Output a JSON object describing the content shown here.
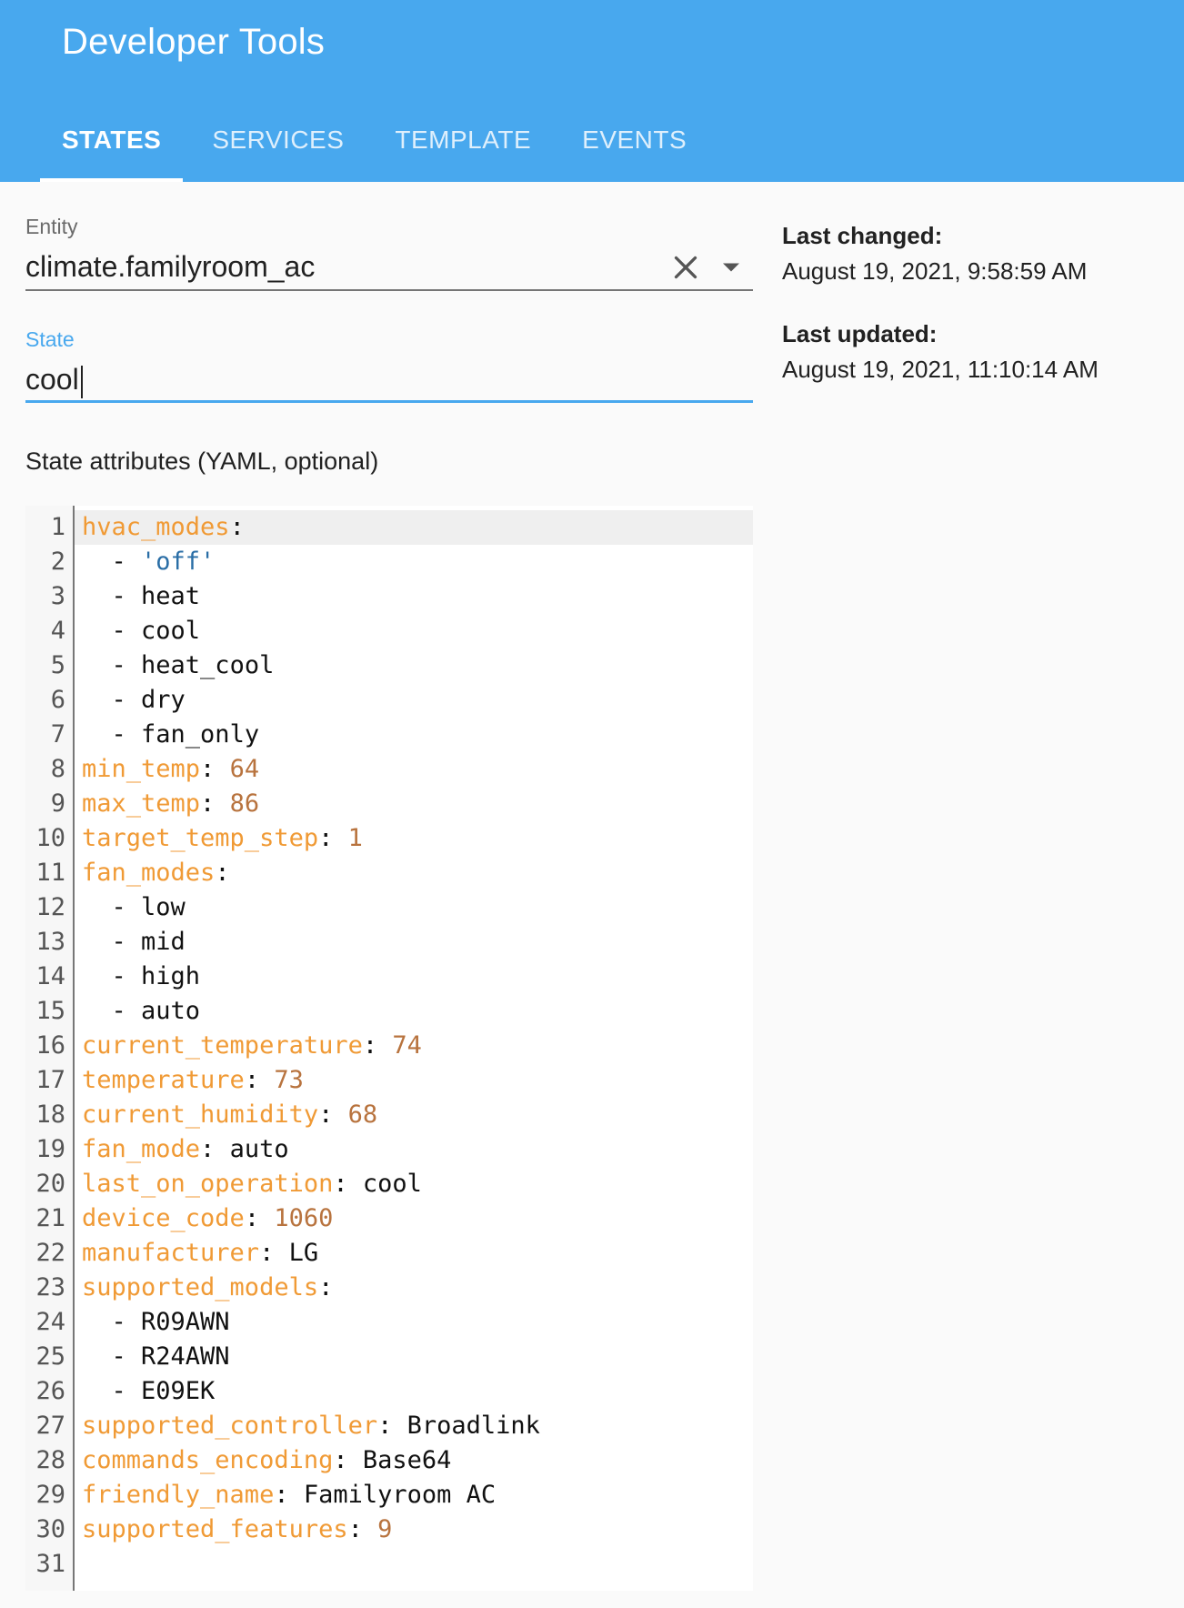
{
  "header": {
    "title": "Developer Tools",
    "tabs": [
      {
        "label": "STATES",
        "active": true
      },
      {
        "label": "SERVICES",
        "active": false
      },
      {
        "label": "TEMPLATE",
        "active": false
      },
      {
        "label": "EVENTS",
        "active": false
      }
    ]
  },
  "entity": {
    "label": "Entity",
    "value": "climate.familyroom_ac",
    "clear_icon": "close-icon",
    "dropdown_icon": "arrow-drop-down-icon"
  },
  "state": {
    "label": "State",
    "value": "cool"
  },
  "attributes": {
    "label": "State attributes (YAML, optional)",
    "lines": [
      {
        "n": "1",
        "key": "hvac_modes",
        "val": ""
      },
      {
        "n": "2",
        "item": "'off'",
        "item_type": "string"
      },
      {
        "n": "3",
        "item": "heat"
      },
      {
        "n": "4",
        "item": "cool"
      },
      {
        "n": "5",
        "item": "heat_cool"
      },
      {
        "n": "6",
        "item": "dry"
      },
      {
        "n": "7",
        "item": "fan_only"
      },
      {
        "n": "8",
        "key": "min_temp",
        "val": "64",
        "val_type": "number"
      },
      {
        "n": "9",
        "key": "max_temp",
        "val": "86",
        "val_type": "number"
      },
      {
        "n": "10",
        "key": "target_temp_step",
        "val": "1",
        "val_type": "number"
      },
      {
        "n": "11",
        "key": "fan_modes",
        "val": ""
      },
      {
        "n": "12",
        "item": "low"
      },
      {
        "n": "13",
        "item": "mid"
      },
      {
        "n": "14",
        "item": "high"
      },
      {
        "n": "15",
        "item": "auto"
      },
      {
        "n": "16",
        "key": "current_temperature",
        "val": "74",
        "val_type": "number"
      },
      {
        "n": "17",
        "key": "temperature",
        "val": "73",
        "val_type": "number"
      },
      {
        "n": "18",
        "key": "current_humidity",
        "val": "68",
        "val_type": "number"
      },
      {
        "n": "19",
        "key": "fan_mode",
        "val": "auto"
      },
      {
        "n": "20",
        "key": "last_on_operation",
        "val": "cool"
      },
      {
        "n": "21",
        "key": "device_code",
        "val": "1060",
        "val_type": "number"
      },
      {
        "n": "22",
        "key": "manufacturer",
        "val": "LG"
      },
      {
        "n": "23",
        "key": "supported_models",
        "val": ""
      },
      {
        "n": "24",
        "item": "R09AWN"
      },
      {
        "n": "25",
        "item": "R24AWN"
      },
      {
        "n": "26",
        "item": "E09EK"
      },
      {
        "n": "27",
        "key": "supported_controller",
        "val": "Broadlink"
      },
      {
        "n": "28",
        "key": "commands_encoding",
        "val": "Base64"
      },
      {
        "n": "29",
        "key": "friendly_name",
        "val": "Familyroom AC"
      },
      {
        "n": "30",
        "key": "supported_features",
        "val": "9",
        "val_type": "number"
      },
      {
        "n": "31"
      }
    ]
  },
  "meta": {
    "last_changed_label": "Last changed:",
    "last_changed_value": "August 19, 2021, 9:58:59 AM",
    "last_updated_label": "Last updated:",
    "last_updated_value": "August 19, 2021, 11:10:14 AM"
  },
  "colors": {
    "header_bg": "#48a8ee",
    "yaml_key": "#f09a35",
    "yaml_number": "#b8733e",
    "yaml_string": "#2a6ea6"
  }
}
